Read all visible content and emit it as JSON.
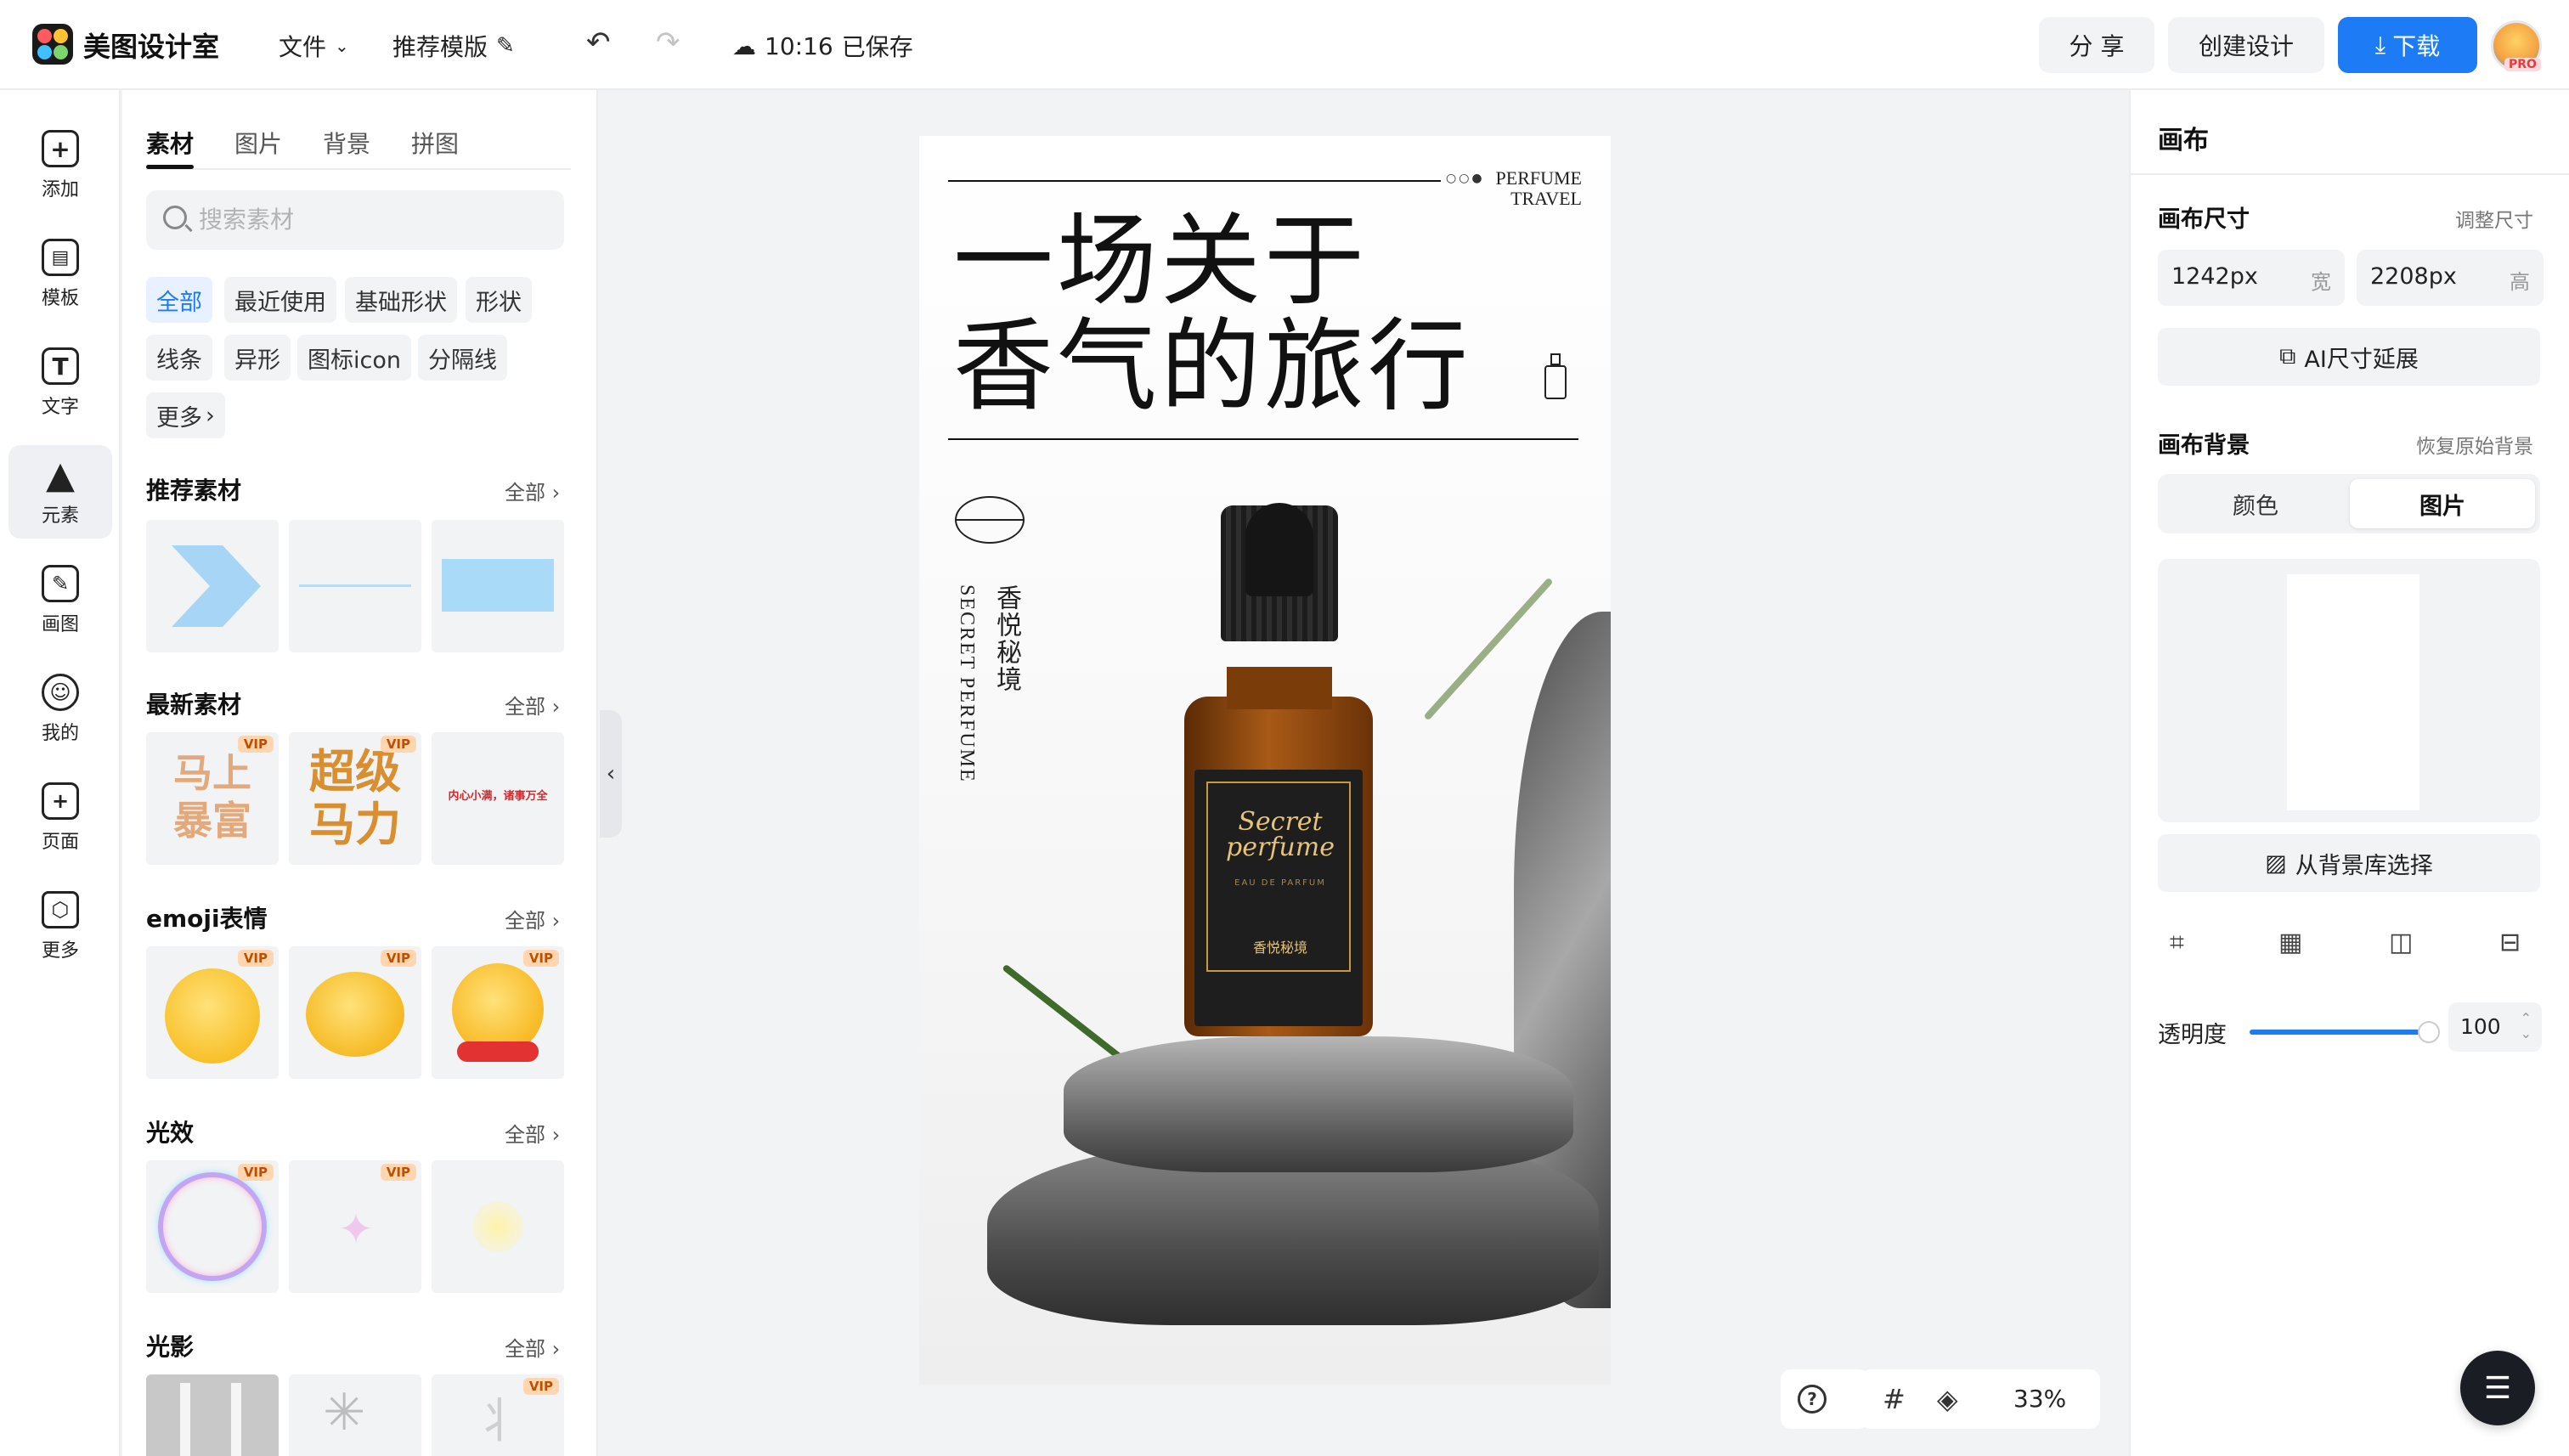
{
  "app": {
    "name": "美图设计室"
  },
  "topbar": {
    "file_label": "文件",
    "recommend_label": "推荐模版",
    "save_time": "10:16",
    "save_status": "已保存",
    "share_label": "分 享",
    "create_label": "创建设计",
    "download_label": "下载",
    "pro_badge": "PRO"
  },
  "leftnav": {
    "items": [
      {
        "label": "添加",
        "icon": "plus-square-icon"
      },
      {
        "label": "模板",
        "icon": "layout-icon"
      },
      {
        "label": "文字",
        "icon": "text-icon"
      },
      {
        "label": "元素",
        "icon": "shapes-icon"
      },
      {
        "label": "画图",
        "icon": "draw-icon"
      },
      {
        "label": "我的",
        "icon": "user-icon"
      },
      {
        "label": "页面",
        "icon": "page-icon"
      },
      {
        "label": "更多",
        "icon": "cube-icon"
      }
    ]
  },
  "panel": {
    "tabs": [
      "素材",
      "图片",
      "背景",
      "拼图"
    ],
    "search_placeholder": "搜索素材",
    "chips": [
      "全部",
      "最近使用",
      "基础形状",
      "形状",
      "线条",
      "异形",
      "图标icon",
      "分隔线",
      "更多"
    ],
    "sections": [
      {
        "title": "推荐素材",
        "all": "全部"
      },
      {
        "title": "最新素材",
        "all": "全部",
        "thumb_texts": [
          "马上暴富",
          "超级马力",
          "内心小满，诸事万全"
        ]
      },
      {
        "title": "emoji表情",
        "all": "全部"
      },
      {
        "title": "光效",
        "all": "全部"
      },
      {
        "title": "光影",
        "all": "全部"
      }
    ],
    "vip": "VIP"
  },
  "poster": {
    "title_line1": "一场关于",
    "title_line2": "香气的旅行",
    "brand_line1": "PERFUME",
    "brand_line2": "TRAVEL",
    "vertical_cn": "香悦秘境",
    "vertical_en": "SECRET PERFUME",
    "label_script1": "Secret",
    "label_script2": "perfume",
    "label_small": "EAU DE PARFUM",
    "label_cn": "香悦秘境"
  },
  "canvas_tools": {
    "zoom": "33%"
  },
  "rightpanel": {
    "title": "画布",
    "size_label": "画布尺寸",
    "resize_link": "调整尺寸",
    "width_value": "1242px",
    "width_unit": "宽",
    "height_value": "2208px",
    "height_unit": "高",
    "ai_extend": "AI尺寸延展",
    "bg_label": "画布背景",
    "restore_link": "恢复原始背景",
    "seg_color": "颜色",
    "seg_image": "图片",
    "from_library": "从背景库选择",
    "opacity_label": "透明度",
    "opacity_value": "100",
    "opacity_fraction": 1.0
  },
  "colors": {
    "accent": "#1d7bf6",
    "vip": "#ffd6b0",
    "label_gold": "#e6c37a"
  }
}
